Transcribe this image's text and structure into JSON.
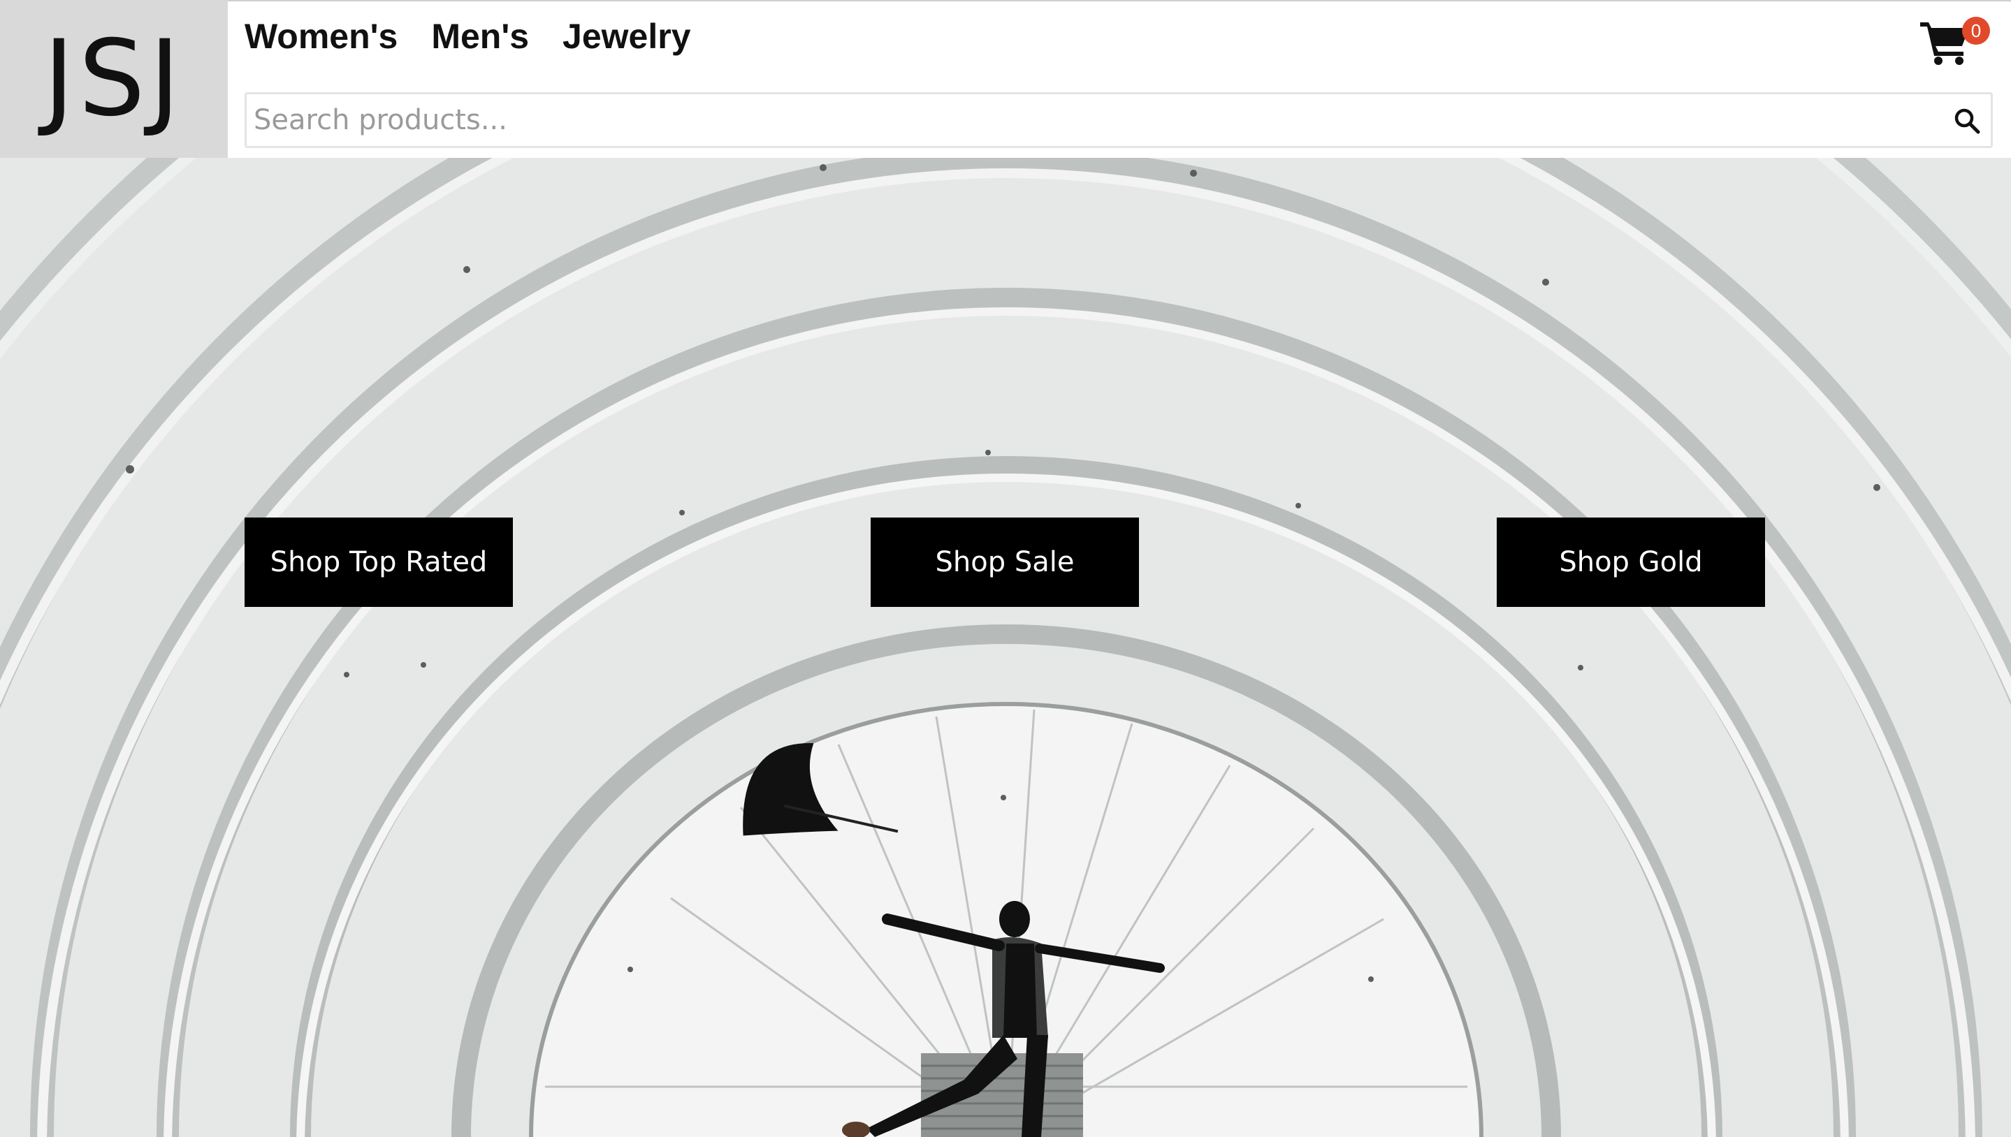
{
  "logo": {
    "text": "JSJ"
  },
  "nav": {
    "items": [
      {
        "label": "Women's"
      },
      {
        "label": "Men's"
      },
      {
        "label": "Jewelry"
      }
    ]
  },
  "cart": {
    "count": "0",
    "icon": "shopping-cart-icon",
    "badge_color": "#e04a2b"
  },
  "search": {
    "placeholder": "Search products...",
    "value": "",
    "icon": "search-icon"
  },
  "hero": {
    "image": "woman-with-umbrella-under-white-arches",
    "buttons": [
      {
        "label": "Shop Top Rated"
      },
      {
        "label": "Shop Sale"
      },
      {
        "label": "Shop Gold"
      }
    ]
  },
  "colors": {
    "logo_bg": "#d9d9d9",
    "button_bg": "#000000",
    "button_text": "#ffffff"
  }
}
